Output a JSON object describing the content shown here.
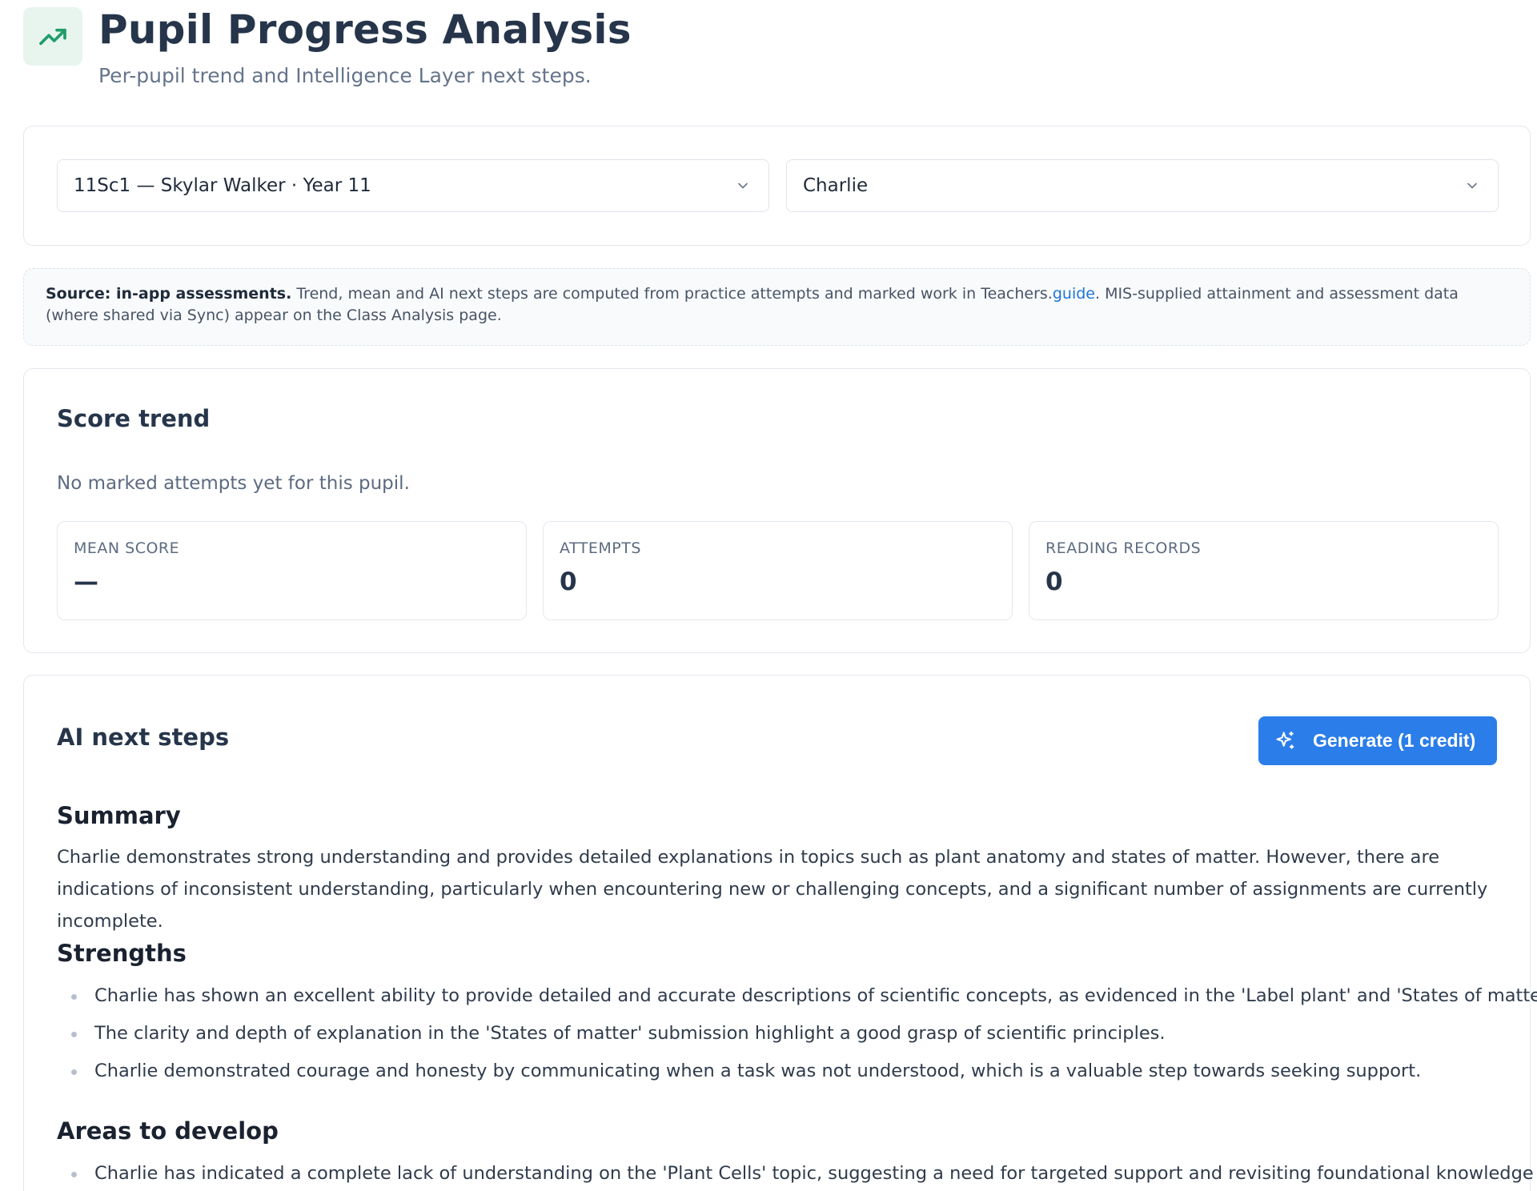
{
  "header": {
    "title": "Pupil Progress Analysis",
    "subtitle": "Per-pupil trend and Intelligence Layer next steps.",
    "icon": "trending-up-icon"
  },
  "selectors": {
    "class_value": "11Sc1 — Skylar Walker · Year 11",
    "pupil_value": "Charlie"
  },
  "source_note": {
    "label": "Source: in-app assessments.",
    "text_before_link": " Trend, mean and AI next steps are computed from practice attempts and marked work in Teachers.",
    "link": "guide",
    "text_after_link": ". MIS-supplied attainment and assessment data (where shared via Sync) appear on the Class Analysis page."
  },
  "score_trend": {
    "title": "Score trend",
    "empty_message": "No marked attempts yet for this pupil.",
    "stats": [
      {
        "label": "MEAN SCORE",
        "value": "—"
      },
      {
        "label": "ATTEMPTS",
        "value": "0"
      },
      {
        "label": "READING RECORDS",
        "value": "0"
      }
    ]
  },
  "ai_next_steps": {
    "title": "AI next steps",
    "generate_label": "Generate (1 credit)",
    "summary_heading": "Summary",
    "summary_text": "Charlie demonstrates strong understanding and provides detailed explanations in topics such as plant anatomy and states of matter. However, there are indications of inconsistent understanding, particularly when encountering new or challenging concepts, and a significant number of assignments are currently incomplete.",
    "strengths_heading": "Strengths",
    "strengths": [
      "Charlie has shown an excellent ability to provide detailed and accurate descriptions of scientific concepts, as evidenced in the 'Label plant' and 'States of matter' work.",
      "The clarity and depth of explanation in the 'States of matter' submission highlight a good grasp of scientific principles.",
      "Charlie demonstrated courage and honesty by communicating when a task was not understood, which is a valuable step towards seeking support."
    ],
    "areas_heading": "Areas to develop",
    "areas": [
      "Charlie has indicated a complete lack of understanding on the 'Plant Cells' topic, suggesting a need for targeted support and revisiting foundational knowledge in"
    ]
  },
  "colors": {
    "accent": "#2b7de9",
    "icon_bg": "#e8f5ef",
    "icon_green": "#1f9d6b",
    "link": "#1f74d4"
  }
}
